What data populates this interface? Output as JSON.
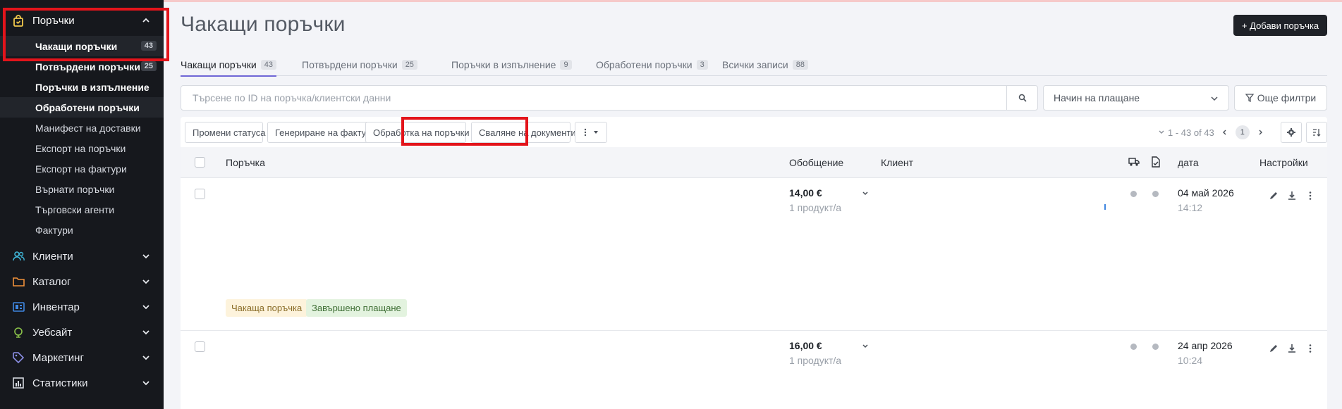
{
  "sidebar": {
    "orders": {
      "label": "Поръчки",
      "items": [
        {
          "label": "Чакащи поръчки",
          "count": "43"
        },
        {
          "label": "Потвърдени поръчки",
          "count": "25"
        },
        {
          "label": "Поръчки в изпълнение"
        },
        {
          "label": "Обработени поръчки"
        },
        {
          "label": "Манифест на доставки"
        },
        {
          "label": "Експорт на поръчки"
        },
        {
          "label": "Експорт на фактури"
        },
        {
          "label": "Върнати поръчки"
        },
        {
          "label": "Търговски агенти"
        },
        {
          "label": "Фактури"
        }
      ]
    },
    "groups": [
      {
        "label": "Клиенти",
        "icon": "users-icon",
        "color": "#3fb6d8"
      },
      {
        "label": "Каталог",
        "icon": "folder-icon",
        "color": "#f0913a"
      },
      {
        "label": "Инвентар",
        "icon": "inventory-icon",
        "color": "#3f86e0"
      },
      {
        "label": "Уебсайт",
        "icon": "globe-icon",
        "color": "#8bc34a"
      },
      {
        "label": "Маркетинг",
        "icon": "tag-icon",
        "color": "#8c8fe6"
      },
      {
        "label": "Статистики",
        "icon": "chart-icon",
        "color": "#d5d8df"
      }
    ]
  },
  "header": {
    "title": "Чакащи поръчки",
    "add_button": "+ Добави поръчка"
  },
  "tabs": [
    {
      "label": "Чакащи поръчки",
      "count": "43"
    },
    {
      "label": "Потвърдени поръчки",
      "count": "25"
    },
    {
      "label": "Поръчки в изпълнение",
      "count": "9"
    },
    {
      "label": "Обработени поръчки",
      "count": "3"
    },
    {
      "label": "Всички записи",
      "count": "88"
    }
  ],
  "filters": {
    "search_placeholder": "Търсене по ID на поръчка/клиентски данни",
    "payment_method": "Начин на плащане",
    "more_filters": "Още филтри"
  },
  "toolbar": {
    "change_status": "Промени статуса",
    "generate_invoices": "Генериране на фактури",
    "process_orders": "Обработка на поръчки",
    "download_documents": "Сваляне на документи",
    "range": "1 - 43 of 43",
    "page": "1"
  },
  "table": {
    "headers": {
      "order": "Поръчка",
      "summary": "Обобщение",
      "client": "Клиент",
      "date": "дата",
      "settings": "Настройки"
    },
    "rows": [
      {
        "amount": "14,00 €",
        "products": "1 продукт/а",
        "date": "04 май 2026",
        "time": "14:12",
        "status": "Чакаща поръчка",
        "payment": "Завършено плащане"
      },
      {
        "amount": "16,00 €",
        "products": "1 продукт/а",
        "date": "24 апр 2026",
        "time": "10:24"
      }
    ]
  },
  "colors": {
    "highlight": "#e3141b",
    "accent_tab": "#6f66d6",
    "orders_icon": "#f2c94c"
  }
}
